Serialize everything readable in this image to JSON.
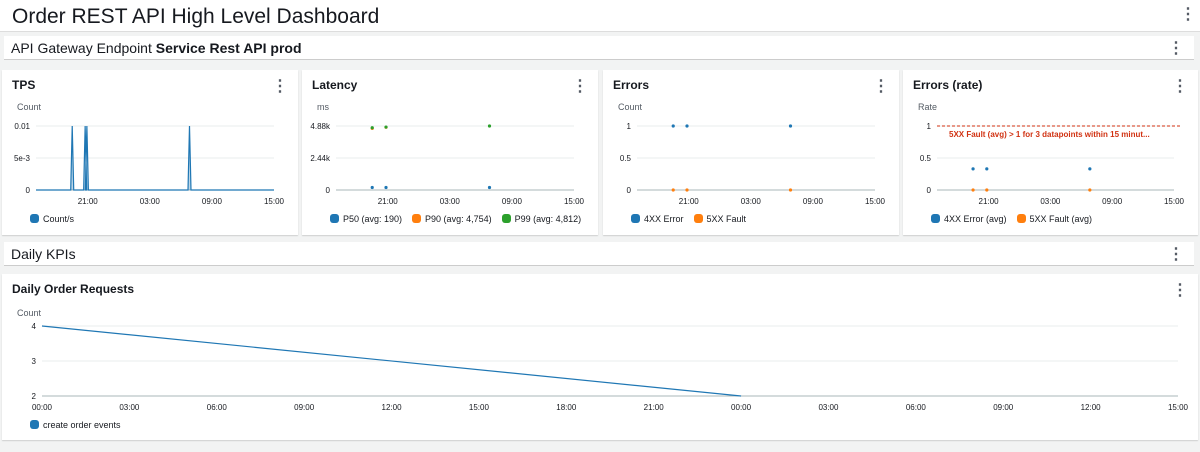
{
  "dashboard": {
    "title": "Order REST API High Level Dashboard"
  },
  "section1": {
    "prefix": "API Gateway Endpoint ",
    "name": "Service Rest API prod"
  },
  "section2": {
    "title": "Daily KPIs"
  },
  "colors": {
    "blue": "#1f77b4",
    "orange": "#ff7f0e",
    "green": "#2ca02c",
    "alarm": "#d13212"
  },
  "chart_data": [
    {
      "id": "tps",
      "title": "TPS",
      "type": "line",
      "ylabel": "Count",
      "yticks": [
        "0",
        "5e-3",
        "0.01"
      ],
      "ylim": [
        0,
        0.01
      ],
      "xlim": [
        "16:00",
        "15:00"
      ],
      "xticks": [
        "21:00",
        "03:00",
        "09:00",
        "15:00"
      ],
      "series": [
        {
          "name": "Count/s",
          "color": "#1f77b4",
          "spikes": [
            "19:30",
            "20:45",
            "20:55",
            "06:50"
          ],
          "peak": 0.01,
          "base": 0
        }
      ]
    },
    {
      "id": "latency",
      "title": "Latency",
      "type": "scatter",
      "ylabel": "ms",
      "yticks": [
        "0",
        "2.44k",
        "4.88k"
      ],
      "ylim": [
        0,
        4880
      ],
      "xlim": [
        "16:00",
        "15:00"
      ],
      "xticks": [
        "21:00",
        "03:00",
        "09:00",
        "15:00"
      ],
      "series": [
        {
          "name": "P50 (avg: 190)",
          "color": "#1f77b4",
          "points": [
            [
              "19:30",
              190
            ],
            [
              "20:50",
              190
            ],
            [
              "06:50",
              190
            ]
          ]
        },
        {
          "name": "P90 (avg: 4,754)",
          "color": "#ff7f0e",
          "points": [
            [
              "19:30",
              4700
            ],
            [
              "20:50",
              4780
            ]
          ]
        },
        {
          "name": "P99 (avg: 4,812)",
          "color": "#2ca02c",
          "points": [
            [
              "19:30",
              4750
            ],
            [
              "20:50",
              4800
            ],
            [
              "06:50",
              4880
            ]
          ]
        }
      ]
    },
    {
      "id": "errors",
      "title": "Errors",
      "type": "scatter",
      "ylabel": "Count",
      "yticks": [
        "0",
        "0.5",
        "1"
      ],
      "ylim": [
        0,
        1
      ],
      "xlim": [
        "16:00",
        "15:00"
      ],
      "xticks": [
        "21:00",
        "03:00",
        "09:00",
        "15:00"
      ],
      "series": [
        {
          "name": "4XX Error",
          "color": "#1f77b4",
          "points": [
            [
              "19:30",
              1
            ],
            [
              "20:50",
              1
            ],
            [
              "06:50",
              1
            ]
          ]
        },
        {
          "name": "5XX Fault",
          "color": "#ff7f0e",
          "points": [
            [
              "19:30",
              0
            ],
            [
              "20:50",
              0
            ],
            [
              "06:50",
              0
            ]
          ]
        }
      ]
    },
    {
      "id": "rate",
      "title": "Errors (rate)",
      "type": "scatter",
      "ylabel": "Rate",
      "yticks": [
        "0",
        "0.5",
        "1"
      ],
      "ylim": [
        0,
        1
      ],
      "xlim": [
        "16:00",
        "15:00"
      ],
      "xticks": [
        "21:00",
        "03:00",
        "09:00",
        "15:00"
      ],
      "threshold": {
        "value": 1,
        "label": "5XX Fault (avg) > 1 for 3 datapoints within 15 minut..."
      },
      "series": [
        {
          "name": "4XX Error (avg)",
          "color": "#1f77b4",
          "points": [
            [
              "19:30",
              0.33
            ],
            [
              "20:50",
              0.33
            ],
            [
              "06:50",
              0.33
            ]
          ]
        },
        {
          "name": "5XX Fault (avg)",
          "color": "#ff7f0e",
          "points": [
            [
              "19:30",
              0
            ],
            [
              "20:50",
              0
            ],
            [
              "06:50",
              0
            ]
          ]
        }
      ]
    },
    {
      "id": "daily",
      "title": "Daily Order Requests",
      "type": "line",
      "ylabel": "Count",
      "yticks": [
        "2",
        "3",
        "4"
      ],
      "ylim": [
        2,
        4
      ],
      "xlim": [
        "00:00",
        "15:00 +1"
      ],
      "xticks": [
        "00:00",
        "03:00",
        "06:00",
        "09:00",
        "12:00",
        "15:00",
        "18:00",
        "21:00",
        "00:00",
        "03:00",
        "06:00",
        "09:00",
        "12:00",
        "15:00"
      ],
      "series": [
        {
          "name": "create order events",
          "color": "#1f77b4",
          "points": [
            [
              "00:00",
              4
            ],
            [
              "00:00 +1",
              2
            ]
          ]
        }
      ]
    }
  ]
}
